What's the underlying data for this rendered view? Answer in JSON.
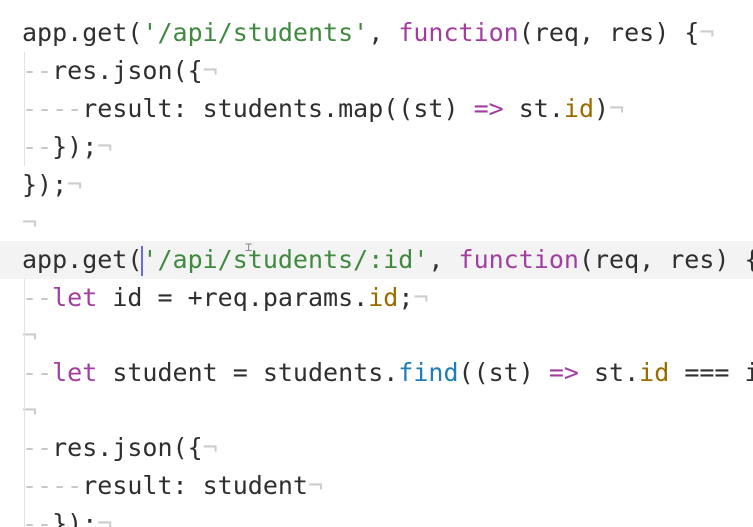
{
  "code": {
    "line1": {
      "obj": "app.get(",
      "route": "'/api/students'",
      "sep": ", ",
      "kw": "function",
      "args": "(req, res) {"
    },
    "line2": {
      "indent": "--",
      "text": "res.json({"
    },
    "line3": {
      "indent": "----",
      "text1": "result: students.map((st) ",
      "arrow": "=>",
      "text2": " st.",
      "prop": "id",
      "text3": ")"
    },
    "line4": {
      "indent": "--",
      "text": "});"
    },
    "line5": {
      "text": "});"
    },
    "line7": {
      "obj": "app.get(",
      "route": "'/api/students/:id'",
      "sep": ", ",
      "kw": "function",
      "args": "(req, res) {"
    },
    "line8": {
      "indent": "--",
      "kw": "let",
      "text1": " id = +req.params.",
      "prop": "id",
      "text2": ";"
    },
    "line10": {
      "indent": "--",
      "kw": "let",
      "text1": " student = students.",
      "fn": "find",
      "text2": "((st) ",
      "arrow": "=>",
      "text3": " st.",
      "prop": "id",
      "text4": " === i"
    },
    "line12": {
      "indent": "--",
      "text": "res.json({"
    },
    "line13": {
      "indent": "----",
      "text": "result: student"
    },
    "line14": {
      "indent": "--",
      "text": "});"
    },
    "newline_marker": "¬"
  }
}
